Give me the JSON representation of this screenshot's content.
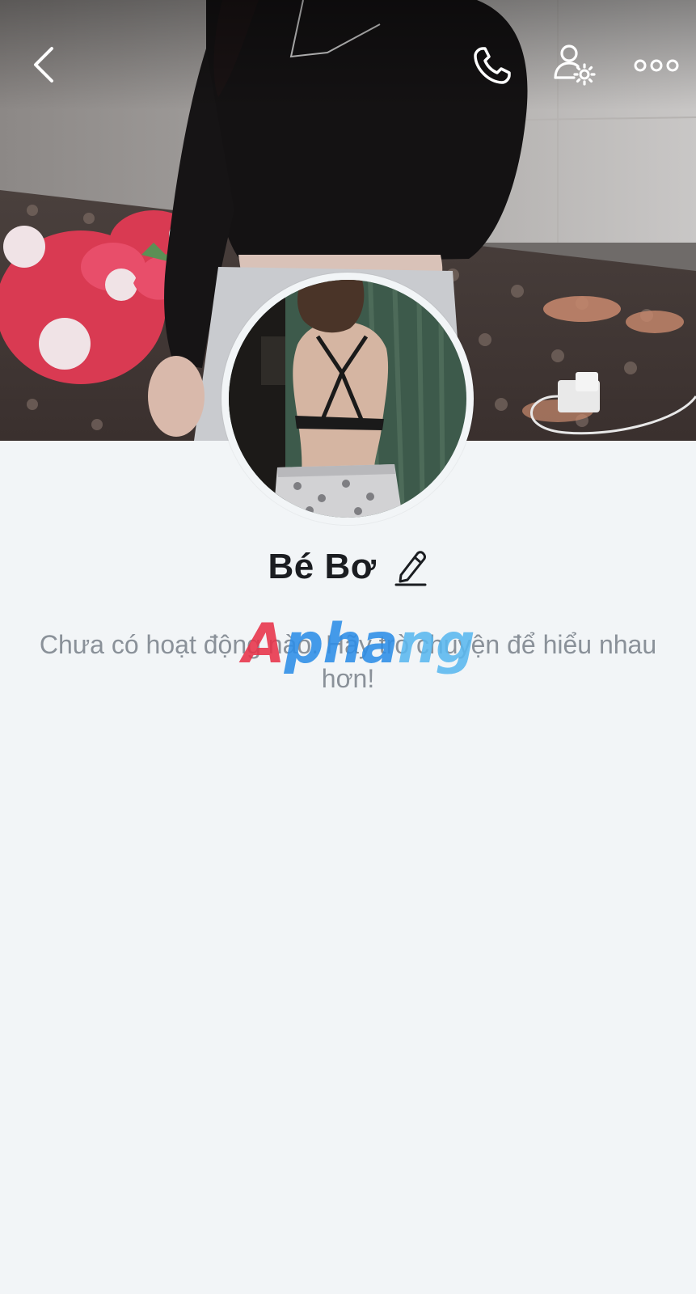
{
  "header": {
    "back_icon": "chevron-left-icon",
    "call_icon": "phone-icon",
    "settings_icon": "user-gear-icon",
    "more_icon": "ellipsis-icon"
  },
  "cover": {
    "kind": "cover-photo"
  },
  "avatar": {
    "kind": "profile-photo"
  },
  "profile": {
    "name": "Bé Bơ",
    "edit_icon": "pencil-icon"
  },
  "activity": {
    "empty_message": "Chưa có hoạt động nào. Hãy trò chuyện để hiểu nhau hơn!"
  },
  "watermark": {
    "text": "Aphang"
  },
  "colors": {
    "page_background": "#f2f5f7",
    "name_text": "#1b1d21",
    "muted_text": "#8a9199",
    "header_icon": "#ffffff"
  }
}
